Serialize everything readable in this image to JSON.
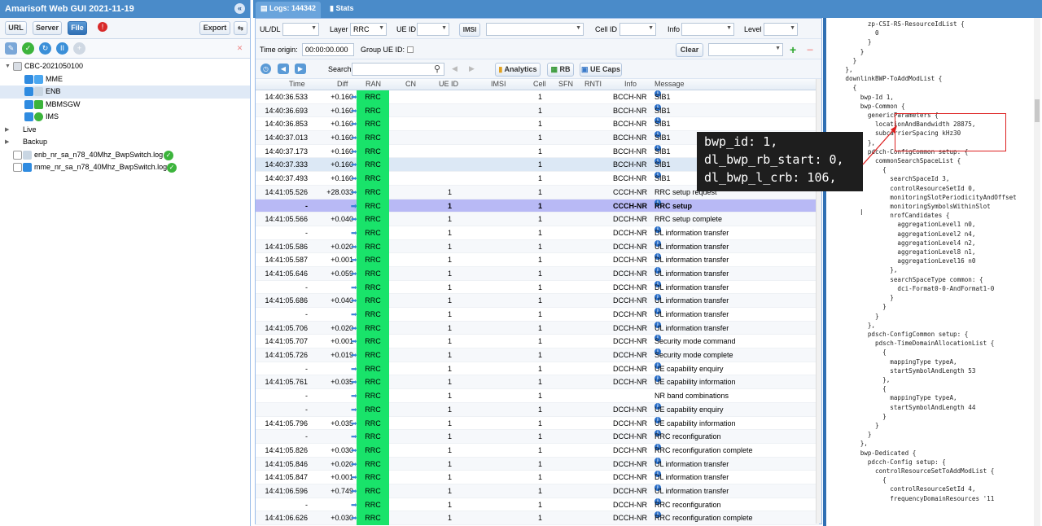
{
  "app": {
    "title": "Amarisoft Web GUI 2021-11-19"
  },
  "left_toolbar": {
    "url": "URL",
    "server": "Server",
    "file": "File",
    "export": "Export"
  },
  "tree": {
    "root": "CBC-2021050100",
    "children": [
      "MME",
      "ENB",
      "MBMSGW",
      "IMS"
    ],
    "live": "Live",
    "backup": "Backup",
    "files": [
      "enb_nr_sa_n78_40Mhz_BwpSwitch.log",
      "mme_nr_sa_n78_40Mhz_BwpSwitch.log"
    ]
  },
  "tabs": {
    "logs": "Logs: 144342",
    "stats": "Stats"
  },
  "filters": {
    "uldl": "UL/DL",
    "layer": "Layer",
    "layer_value": "RRC",
    "ueid": "UE ID",
    "imsi": "IMSI",
    "cellid": "Cell ID",
    "info": "Info",
    "level": "Level",
    "time_origin": "Time origin:",
    "time_origin_value": "00:00:00.000",
    "group_ueid": "Group UE ID:",
    "clear": "Clear",
    "search": "Search",
    "analytics": "Analytics",
    "rb": "RB",
    "uecaps": "UE Caps"
  },
  "columns": [
    "Time",
    "Diff",
    "RAN",
    "CN",
    "UE ID",
    "IMSI",
    "Cell",
    "SFN",
    "RNTI",
    "Info",
    "Message"
  ],
  "rows": [
    {
      "time": "14:40:36.533",
      "diff": "+0.160",
      "ran": "RRC",
      "ueid": "",
      "cell": "1",
      "info": "BCCH-NR",
      "msg": "SIB1",
      "i": true
    },
    {
      "time": "14:40:36.693",
      "diff": "+0.160",
      "ran": "RRC",
      "ueid": "",
      "cell": "1",
      "info": "BCCH-NR",
      "msg": "SIB1",
      "i": true
    },
    {
      "time": "14:40:36.853",
      "diff": "+0.160",
      "ran": "RRC",
      "ueid": "",
      "cell": "1",
      "info": "BCCH-NR",
      "msg": "SIB1",
      "i": true
    },
    {
      "time": "14:40:37.013",
      "diff": "+0.160",
      "ran": "RRC",
      "ueid": "",
      "cell": "1",
      "info": "BCCH-NR",
      "msg": "SIB1",
      "i": true
    },
    {
      "time": "14:40:37.173",
      "diff": "+0.160",
      "ran": "RRC",
      "ueid": "",
      "cell": "1",
      "info": "BCCH-NR",
      "msg": "SIB1",
      "i": true
    },
    {
      "time": "14:40:37.333",
      "diff": "+0.160",
      "ran": "RRC",
      "ueid": "",
      "cell": "1",
      "info": "BCCH-NR",
      "msg": "SIB1",
      "i": true,
      "hl": true
    },
    {
      "time": "14:40:37.493",
      "diff": "+0.160",
      "ran": "RRC",
      "ueid": "",
      "cell": "1",
      "info": "BCCH-NR",
      "msg": "SIB1",
      "i": true
    },
    {
      "time": "14:41:05.526",
      "diff": "+28.033",
      "ran": "RRC",
      "ueid": "1",
      "cell": "1",
      "info": "CCCH-NR",
      "msg": "RRC setup request",
      "i": false
    },
    {
      "time": "-",
      "diff": "",
      "ran": "RRC",
      "ueid": "1",
      "cell": "1",
      "info": "CCCH-NR",
      "msg": "RRC setup",
      "i": true,
      "sel": true
    },
    {
      "time": "14:41:05.566",
      "diff": "+0.040",
      "ran": "RRC",
      "ueid": "1",
      "cell": "1",
      "info": "DCCH-NR",
      "msg": "RRC setup complete",
      "i": false
    },
    {
      "time": "-",
      "diff": "",
      "ran": "RRC",
      "ueid": "1",
      "cell": "1",
      "info": "DCCH-NR",
      "msg": "DL information transfer",
      "i": true
    },
    {
      "time": "14:41:05.586",
      "diff": "+0.020",
      "ran": "RRC",
      "ueid": "1",
      "cell": "1",
      "info": "DCCH-NR",
      "msg": "UL information transfer",
      "i": true
    },
    {
      "time": "14:41:05.587",
      "diff": "+0.001",
      "ran": "RRC",
      "ueid": "1",
      "cell": "1",
      "info": "DCCH-NR",
      "msg": "DL information transfer",
      "i": true
    },
    {
      "time": "14:41:05.646",
      "diff": "+0.059",
      "ran": "RRC",
      "ueid": "1",
      "cell": "1",
      "info": "DCCH-NR",
      "msg": "UL information transfer",
      "i": true
    },
    {
      "time": "-",
      "diff": "",
      "ran": "RRC",
      "ueid": "1",
      "cell": "1",
      "info": "DCCH-NR",
      "msg": "DL information transfer",
      "i": true
    },
    {
      "time": "14:41:05.686",
      "diff": "+0.040",
      "ran": "RRC",
      "ueid": "1",
      "cell": "1",
      "info": "DCCH-NR",
      "msg": "UL information transfer",
      "i": true
    },
    {
      "time": "-",
      "diff": "",
      "ran": "RRC",
      "ueid": "1",
      "cell": "1",
      "info": "DCCH-NR",
      "msg": "UL information transfer",
      "i": true
    },
    {
      "time": "14:41:05.706",
      "diff": "+0.020",
      "ran": "RRC",
      "ueid": "1",
      "cell": "1",
      "info": "DCCH-NR",
      "msg": "UL information transfer",
      "i": true
    },
    {
      "time": "14:41:05.707",
      "diff": "+0.001",
      "ran": "RRC",
      "ueid": "1",
      "cell": "1",
      "info": "DCCH-NR",
      "msg": "Security mode command",
      "i": true
    },
    {
      "time": "14:41:05.726",
      "diff": "+0.019",
      "ran": "RRC",
      "ueid": "1",
      "cell": "1",
      "info": "DCCH-NR",
      "msg": "Security mode complete",
      "i": true
    },
    {
      "time": "-",
      "diff": "",
      "ran": "RRC",
      "ueid": "1",
      "cell": "1",
      "info": "DCCH-NR",
      "msg": "UE capability enquiry",
      "i": true
    },
    {
      "time": "14:41:05.761",
      "diff": "+0.035",
      "ran": "RRC",
      "ueid": "1",
      "cell": "1",
      "info": "DCCH-NR",
      "msg": "UE capability information",
      "i": true
    },
    {
      "time": "-",
      "diff": "",
      "ran": "RRC",
      "ueid": "1",
      "cell": "1",
      "info": "",
      "msg": "NR band combinations",
      "i": false
    },
    {
      "time": "-",
      "diff": "",
      "ran": "RRC",
      "ueid": "1",
      "cell": "1",
      "info": "DCCH-NR",
      "msg": "UE capability enquiry",
      "i": true
    },
    {
      "time": "14:41:05.796",
      "diff": "+0.035",
      "ran": "RRC",
      "ueid": "1",
      "cell": "1",
      "info": "DCCH-NR",
      "msg": "UE capability information",
      "i": true
    },
    {
      "time": "-",
      "diff": "",
      "ran": "RRC",
      "ueid": "1",
      "cell": "1",
      "info": "DCCH-NR",
      "msg": "RRC reconfiguration",
      "i": true
    },
    {
      "time": "14:41:05.826",
      "diff": "+0.030",
      "ran": "RRC",
      "ueid": "1",
      "cell": "1",
      "info": "DCCH-NR",
      "msg": "RRC reconfiguration complete",
      "i": true
    },
    {
      "time": "14:41:05.846",
      "diff": "+0.020",
      "ran": "RRC",
      "ueid": "1",
      "cell": "1",
      "info": "DCCH-NR",
      "msg": "UL information transfer",
      "i": true
    },
    {
      "time": "14:41:05.847",
      "diff": "+0.001",
      "ran": "RRC",
      "ueid": "1",
      "cell": "1",
      "info": "DCCH-NR",
      "msg": "DL information transfer",
      "i": true
    },
    {
      "time": "14:41:06.596",
      "diff": "+0.749",
      "ran": "RRC",
      "ueid": "1",
      "cell": "1",
      "info": "DCCH-NR",
      "msg": "UL information transfer",
      "i": true
    },
    {
      "time": "-",
      "diff": "",
      "ran": "RRC",
      "ueid": "1",
      "cell": "1",
      "info": "DCCH-NR",
      "msg": "RRC reconfiguration",
      "i": true
    },
    {
      "time": "14:41:06.626",
      "diff": "+0.030",
      "ran": "RRC",
      "ueid": "1",
      "cell": "1",
      "info": "DCCH-NR",
      "msg": "RRC reconfiguration complete",
      "i": true
    }
  ],
  "code_lines": [
    "            zp-CSI-RS-ResourceIdList {",
    "              0",
    "            }",
    "          }",
    "        }",
    "      },",
    "      downlinkBWP-ToAddModList {",
    "        {",
    "          bwp-Id 1,",
    "          bwp-Common {",
    "            genericParameters {",
    "              locationAndBandwidth 28875,",
    "              subcarrierSpacing kHz30",
    "            },",
    "            pdcch-ConfigCommon setup: {",
    "              commonSearchSpaceList {",
    "                {",
    "                  searchSpaceId 3,",
    "                  controlResourceSetId 0,",
    "                  monitoringSlotPeriodicityAndOffset",
    "                  monitoringSymbolsWithinSlot",
    "                  nrofCandidates {",
    "                    aggregationLevel1 n0,",
    "                    aggregationLevel2 n4,",
    "                    aggregationLevel4 n2,",
    "                    aggregationLevel8 n1,",
    "                    aggregationLevel16 n0",
    "                  },",
    "                  searchSpaceType common: {",
    "                    dci-Format0-0-AndFormat1-0",
    "                  }",
    "                }",
    "              }",
    "            },",
    "            pdsch-ConfigCommon setup: {",
    "              pdsch-TimeDomainAllocationList {",
    "                {",
    "                  mappingType typeA,",
    "                  startSymbolAndLength 53",
    "                },",
    "                {",
    "                  mappingType typeA,",
    "                  startSymbolAndLength 44",
    "                }",
    "              }",
    "            }",
    "          },",
    "          bwp-Dedicated {",
    "            pdcch-Config setup: {",
    "              controlResourceSetToAddModList {",
    "                {",
    "                  controlResourceSetId 4,",
    "                  frequencyDomainResources '11"
  ],
  "tooltip": {
    "lines": [
      "bwp_id: 1,",
      "dl_bwp_rb_start: 0,",
      "dl_bwp_l_crb: 106,"
    ]
  },
  "colors": {
    "ran_green": "#19e36a",
    "selected_row": "#b8b9f5",
    "title_blue": "#4a8bc9",
    "highlight_red": "#dd2222"
  }
}
